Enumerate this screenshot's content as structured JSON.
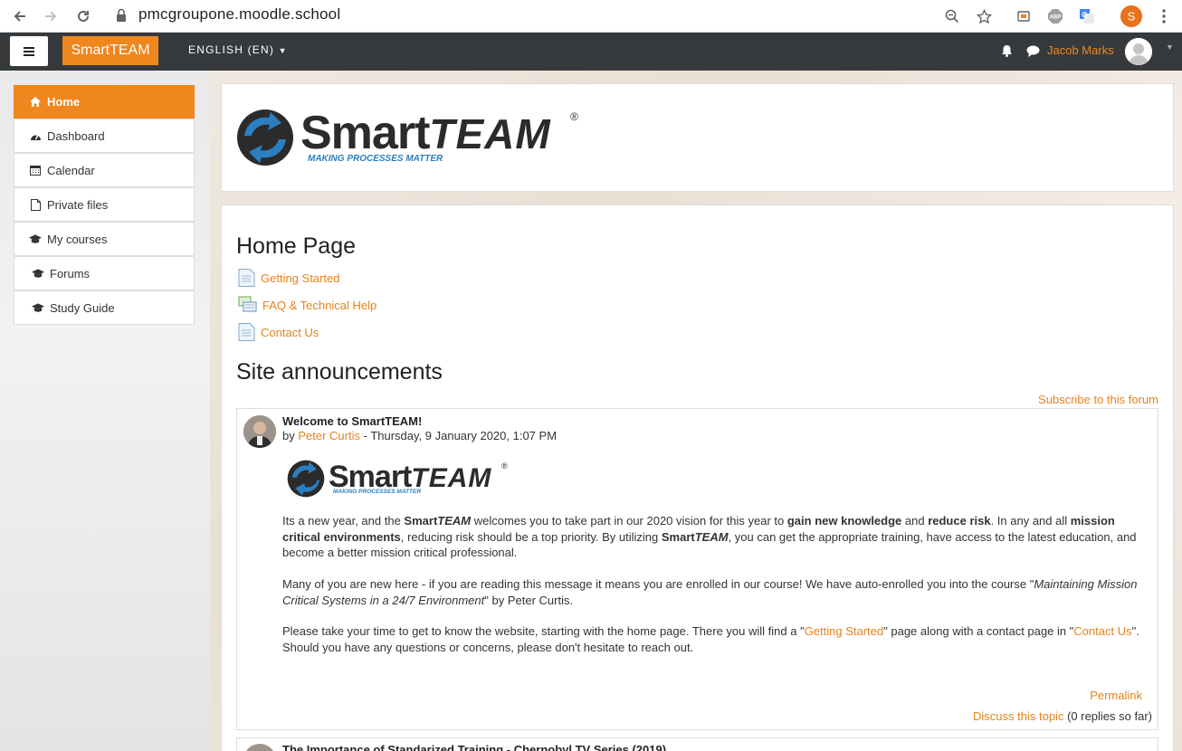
{
  "browser": {
    "url": "pmcgroupone.moodle.school"
  },
  "navbar": {
    "brand": "SmartTEAM",
    "language": "ENGLISH (EN)",
    "user_name": "Jacob Marks"
  },
  "sidebar": {
    "items": [
      {
        "label": "Home",
        "icon": "home-icon",
        "active": true
      },
      {
        "label": "Dashboard",
        "icon": "dashboard-icon"
      },
      {
        "label": "Calendar",
        "icon": "calendar-icon"
      },
      {
        "label": "Private files",
        "icon": "file-icon"
      },
      {
        "label": "My courses",
        "icon": "graduation-cap-icon"
      },
      {
        "label": "Forums",
        "icon": "graduation-cap-icon"
      },
      {
        "label": "Study Guide",
        "icon": "graduation-cap-icon"
      }
    ]
  },
  "logo": {
    "text_smart": "Smart",
    "text_team": "TEAM",
    "tagline": "MAKING PROCESSES MATTER",
    "registered": "®"
  },
  "main": {
    "page_title": "Home Page",
    "resources": [
      "Getting Started",
      "FAQ & Technical Help",
      "Contact Us"
    ],
    "announcements_title": "Site announcements",
    "subscribe": "Subscribe to this forum"
  },
  "post": {
    "title": "Welcome to SmartTEAM!",
    "by": "by",
    "author": "Peter Curtis",
    "date": " - Thursday, 9 January 2020, 1:07 PM",
    "p1": {
      "a": "Its a new year, and the ",
      "smart": "Smart",
      "team": "TEAM",
      "b": " welcomes you to take part in our 2020 vision for this year to ",
      "c": "gain new knowledge",
      "d": " and ",
      "e": "reduce risk",
      "f": ".  In any and all ",
      "g": "mission critical environments",
      "h": ", reducing risk should be a top priority. By utilizing ",
      "i": ", you can get the appropriate training, have access to the latest education, and become a better mission critical professional."
    },
    "p2": {
      "a": "Many of you are new here - if you are reading this message it means you are enrolled in our course!  We have auto-enrolled you into the course \"",
      "b": "Maintaining Mission Critical Systems in a 24/7 Environment",
      "c": "\" by Peter Curtis."
    },
    "p3": {
      "a": "Please take your time to get to know the website, starting with the home page.  There you will find a \"",
      "link1": "Getting Started",
      "b": "\" page along with a contact page in \"",
      "link2": "Contact Us",
      "c": "\".",
      "d": "Should you have any questions or concerns, please don't hesitate to reach out."
    },
    "permalink": "Permalink",
    "discuss": "Discuss this topic",
    "replies": " (0 replies so far)"
  },
  "next_post": {
    "title": "The Importance of Standarized Training - Chernobyl TV Series (2019)"
  },
  "colors": {
    "accent": "#f0861e",
    "navbar": "#373a3c",
    "logo_blue": "#2b7fc1",
    "logo_dark": "#2b2b2b"
  }
}
